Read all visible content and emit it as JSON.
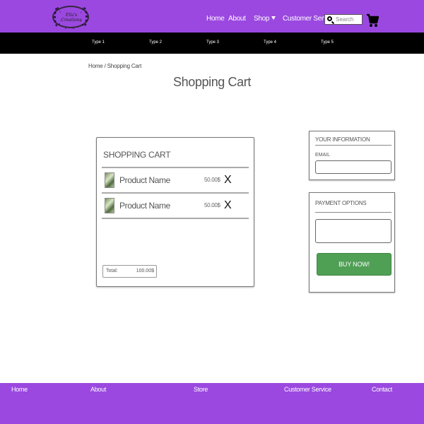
{
  "header": {
    "logo_text": "Ella's Creations",
    "nav": {
      "home": "Home",
      "about": "About",
      "shop": "Shop",
      "customer_service": "Customer Service"
    },
    "search": {
      "placeholder": "Search",
      "value": ""
    },
    "cart_icon": "cart-icon"
  },
  "categories": [
    "Type 1",
    "Type 2",
    "Type 3",
    "Type 4",
    "Type 5"
  ],
  "breadcrumb": "Home / Shopping Cart",
  "page_title": "Shopping Cart",
  "cart": {
    "title": "SHOPPING CART",
    "items": [
      {
        "name": "Product Name",
        "price": "50.00$",
        "remove": "X"
      },
      {
        "name": "Product Name",
        "price": "50.00$",
        "remove": "X"
      }
    ],
    "total_label": "Total:",
    "total_value": "100.00$"
  },
  "info": {
    "title": "YOUR INFORMATION",
    "email_label": "EMAIL",
    "email_value": ""
  },
  "payment": {
    "title": "PAYMENT OPTIONS",
    "button": "BUY NOW!",
    "button_color": "#4f9f55"
  },
  "footer": [
    "Home",
    "About",
    "Store",
    "Customer Service",
    "Contact"
  ],
  "colors": {
    "brand": "#9b48e0",
    "category_bar": "#000000"
  }
}
